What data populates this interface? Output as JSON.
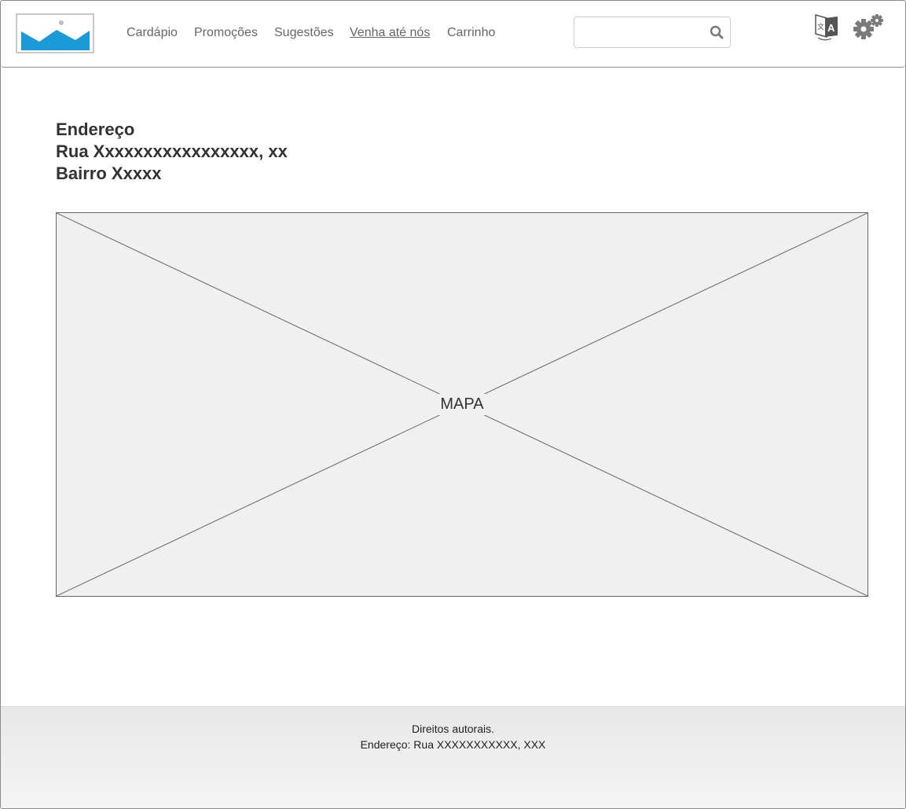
{
  "navbar": {
    "logo_icon": "image-placeholder-icon",
    "links": [
      {
        "label": "Cardápio",
        "active": false
      },
      {
        "label": "Promoções",
        "active": false
      },
      {
        "label": "Sugestões",
        "active": false
      },
      {
        "label": "Venha até nós",
        "active": true
      },
      {
        "label": "Carrinho",
        "active": false
      }
    ],
    "search": {
      "value": "",
      "placeholder": "",
      "icon": "search-icon"
    },
    "icons": {
      "translate": "translate-icon",
      "settings": "gears-icon"
    }
  },
  "address": {
    "heading": "Endereço",
    "street": "Rua Xxxxxxxxxxxxxxxxx, xx",
    "district": "Bairro Xxxxx"
  },
  "map": {
    "label": "MAPA"
  },
  "footer": {
    "line1": "Direitos autorais.",
    "line2": "Endereço: Rua XXXXXXXXXXX, XXX"
  },
  "colors": {
    "logo_blue": "#1a9ad6",
    "nav_text": "#666666",
    "placeholder_bg": "#f0f0f0",
    "icon_gray": "#7a7a7a"
  }
}
